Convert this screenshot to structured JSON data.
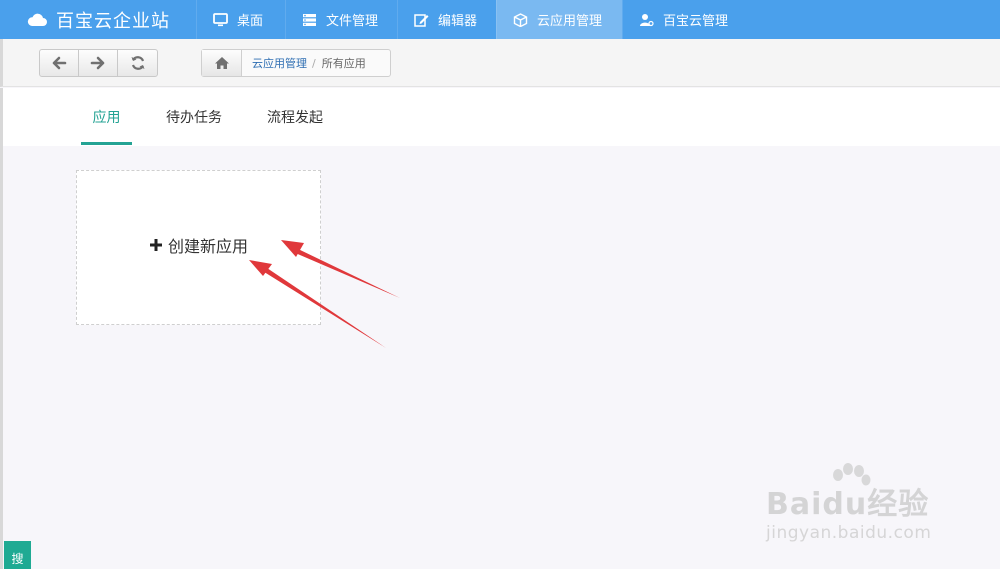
{
  "app": {
    "brand": "百宝云企业站"
  },
  "nav": {
    "items": [
      {
        "label": "桌面",
        "icon": "monitor-icon"
      },
      {
        "label": "文件管理",
        "icon": "server-icon"
      },
      {
        "label": "编辑器",
        "icon": "edit-icon"
      },
      {
        "label": "云应用管理",
        "icon": "cube-icon",
        "active": true
      },
      {
        "label": "百宝云管理",
        "icon": "user-icon"
      }
    ]
  },
  "breadcrumb": {
    "items": [
      "云应用管理",
      "所有应用"
    ],
    "separator": "/"
  },
  "tabs": [
    {
      "label": "应用",
      "active": true
    },
    {
      "label": "待办任务"
    },
    {
      "label": "流程发起"
    }
  ],
  "main": {
    "create_label": "创建新应用"
  },
  "search_tab": {
    "label": "搜"
  },
  "watermark": {
    "brand": "Baidu经验",
    "url": "jingyan.baidu.com"
  },
  "colors": {
    "topbar": "#4aa0ec",
    "topbar_active": "#7ab9f1",
    "accent": "#24a394",
    "annotation_arrow": "#e0383b"
  }
}
